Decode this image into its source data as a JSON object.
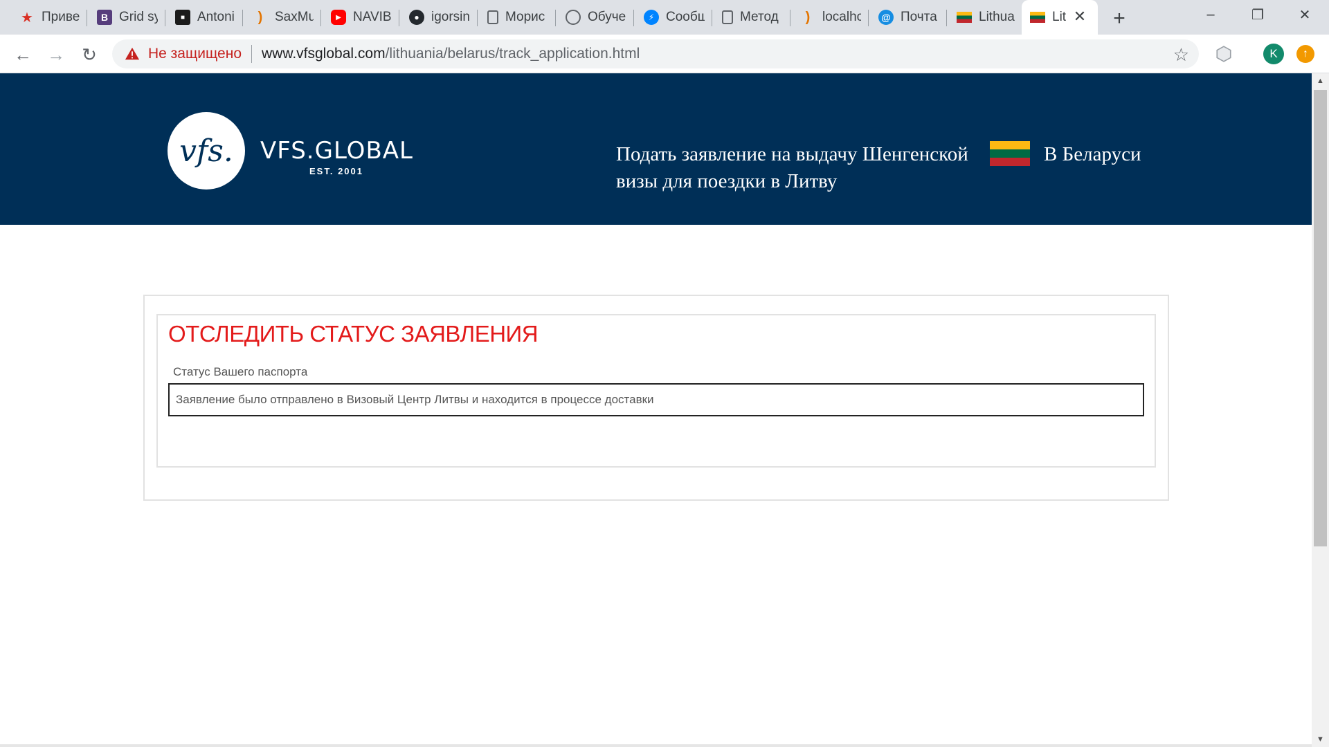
{
  "browser": {
    "tabs": [
      {
        "title": "Приве",
        "icon": "red-figure-icon",
        "color": "#d93025"
      },
      {
        "title": "Grid sy",
        "icon": "bootstrap-icon",
        "color": "#563d7c"
      },
      {
        "title": "Antoni",
        "icon": "dark-square-icon",
        "color": "#1b1b1b"
      },
      {
        "title": "SaxMu",
        "icon": "colorful-swirl-icon",
        "color": "#e37400"
      },
      {
        "title": "NAVIB",
        "icon": "youtube-icon",
        "color": "#ff0000"
      },
      {
        "title": "igorsin",
        "icon": "github-icon",
        "color": "#24292e"
      },
      {
        "title": "Морис",
        "icon": "document-icon",
        "color": "#5f6368"
      },
      {
        "title": "Обуче",
        "icon": "brain-icon",
        "color": "#5f6368"
      },
      {
        "title": "Сообщ",
        "icon": "messenger-icon",
        "color": "#0084ff"
      },
      {
        "title": "Метод",
        "icon": "document-icon",
        "color": "#5f6368"
      },
      {
        "title": "localhc",
        "icon": "colorful-swirl-icon",
        "color": "#e37400"
      },
      {
        "title": "Почта",
        "icon": "mail-at-icon",
        "color": "#168de2"
      },
      {
        "title": "Lithua",
        "icon": "lithuania-flag-icon",
        "color": "#fdb913"
      },
      {
        "title": "Lit",
        "icon": "lithuania-flag-icon",
        "color": "#fdb913",
        "active": true
      }
    ],
    "address": {
      "security_label": "Не защищено",
      "url_host": "www.vfsglobal.com",
      "url_path": "/lithuania/belarus/track_application.html"
    },
    "profile_initial": "K"
  },
  "header": {
    "logo_mark": "vfs.",
    "logo_name": "VFS.GLOBAL",
    "logo_est": "EST. 2001",
    "title": "Подать заявление на выдачу Шенгенской визы для поездки в Литву",
    "country": "В Беларуси",
    "flag_colors": [
      "#fdb913",
      "#006a44",
      "#c1272d"
    ],
    "background": "#002f57"
  },
  "track": {
    "heading": "ОТСЛЕДИТЬ СТАТУС ЗАЯВЛЕНИЯ",
    "heading_color": "#e31b1b",
    "field_label": "Статус Вашего паспорта",
    "status_value": "Заявление было отправлено в Визовый Центр Литвы и находится в процессе доставки"
  }
}
